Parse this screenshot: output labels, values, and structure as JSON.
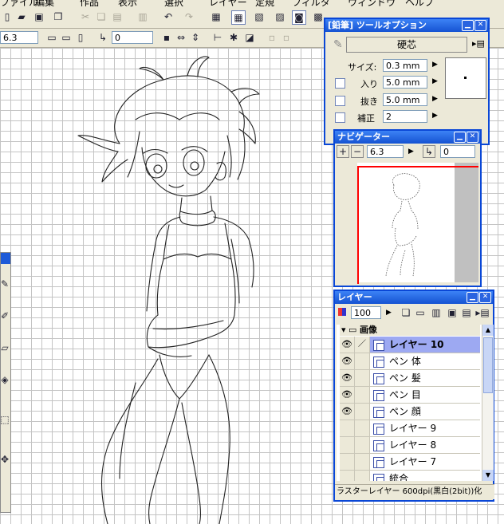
{
  "menu": [
    "ファイル",
    "編集",
    "作品",
    "表示",
    "選択",
    "レイヤー",
    "定規",
    "フィルタ",
    "ウィンドウ",
    "ヘルプ"
  ],
  "toolbar2": {
    "zoom_value": "6.3",
    "rotation_value": "0"
  },
  "tool_options": {
    "title": "[鉛筆] ツールオプション",
    "preset": "硬芯",
    "size_label": "サイズ:",
    "size_value": "0.3 mm",
    "in_label": "入り",
    "in_value": "5.0 mm",
    "out_label": "抜き",
    "out_value": "5.0 mm",
    "correct_label": "補正",
    "correct_value": "2"
  },
  "navigator": {
    "title": "ナビゲーター",
    "zoom_value": "6.3",
    "rotation_value": "0"
  },
  "layers": {
    "title": "レイヤー",
    "opacity": "100",
    "folder": "画像",
    "items": [
      {
        "name": "レイヤー 10",
        "visible": true,
        "selected": true
      },
      {
        "name": "ペン 体",
        "visible": true,
        "selected": false
      },
      {
        "name": "ペン 髪",
        "visible": true,
        "selected": false
      },
      {
        "name": "ペン 目",
        "visible": true,
        "selected": false
      },
      {
        "name": "ペン 顔",
        "visible": true,
        "selected": false
      },
      {
        "name": "レイヤー 9",
        "visible": false,
        "selected": false
      },
      {
        "name": "レイヤー 8",
        "visible": false,
        "selected": false
      },
      {
        "name": "レイヤー 7",
        "visible": false,
        "selected": false
      },
      {
        "name": "統合",
        "visible": false,
        "selected": false
      }
    ],
    "status": "ラスターレイヤー 600dpi(黒白(2bit))化"
  },
  "colors": {
    "titlebar": "#1d5ad8",
    "selected_row": "#9da9f2",
    "nav_frame": "#ff0000"
  }
}
